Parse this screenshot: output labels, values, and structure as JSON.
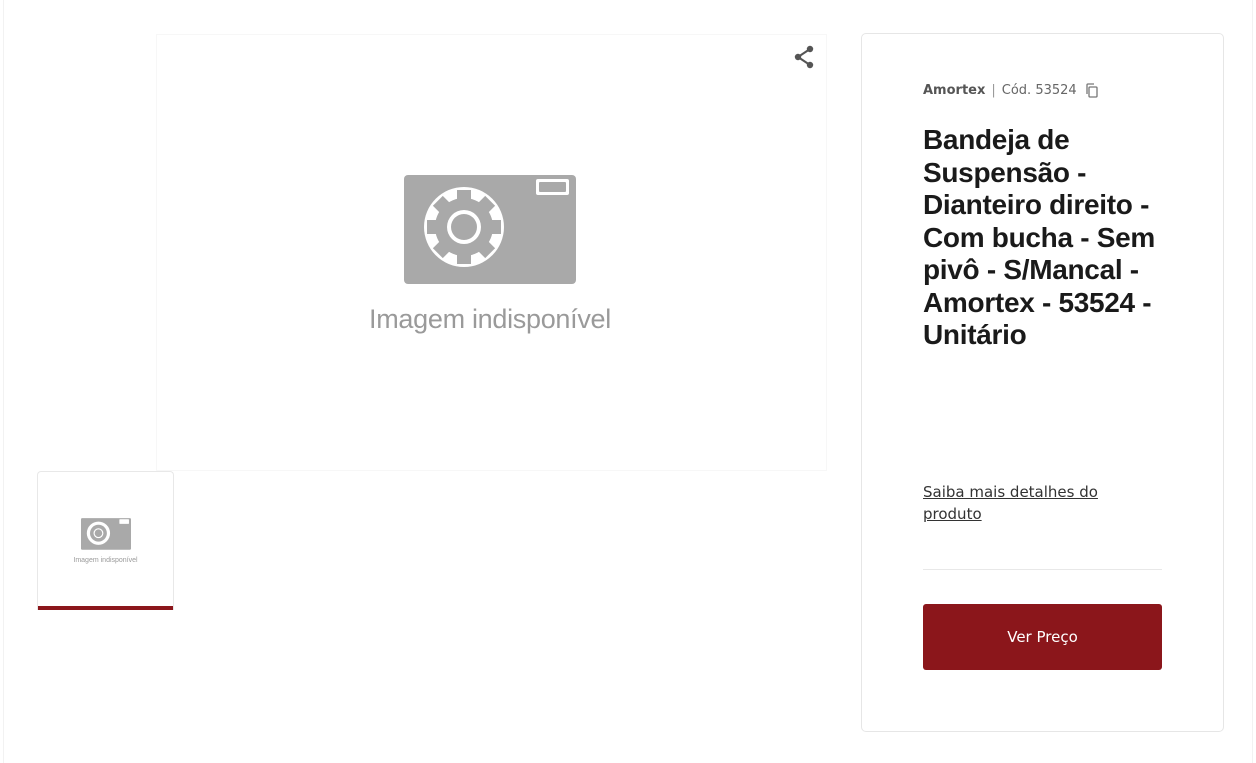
{
  "gallery": {
    "main_placeholder_text": "Imagem indisponível",
    "thumbnail_placeholder_text": "Imagem indisponível",
    "share_icon": "share-icon",
    "camera_icon": "camera-icon"
  },
  "product": {
    "brand": "Amortex",
    "separator": "|",
    "code_label": "Cód. 53524",
    "copy_icon": "copy-icon",
    "title": "Bandeja de Suspensão - Dianteiro direito - Com bucha - Sem pivô - S/Mancal - Amortex - 53524 - Unitário",
    "details_link": "Saiba mais detalhes do produto",
    "price_button": "Ver Preço"
  },
  "colors": {
    "accent": "#8b161b",
    "placeholder_gray": "#a9a9a9"
  }
}
